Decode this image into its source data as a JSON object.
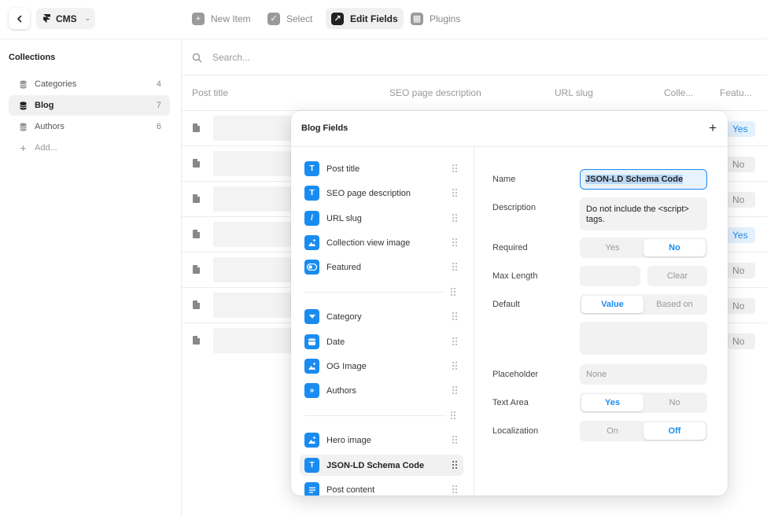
{
  "toolbar": {
    "app_name": "CMS",
    "new_item": "New Item",
    "select": "Select",
    "edit_fields": "Edit Fields",
    "plugins": "Plugins"
  },
  "sidebar": {
    "heading": "Collections",
    "items": [
      {
        "label": "Categories",
        "count": "4"
      },
      {
        "label": "Blog",
        "count": "7"
      },
      {
        "label": "Authors",
        "count": "6"
      }
    ],
    "add": "Add..."
  },
  "search": {
    "placeholder": "Search..."
  },
  "table": {
    "columns": [
      "Post title",
      "SEO page description",
      "URL slug",
      "Colle...",
      "Featu..."
    ],
    "featured": [
      "Yes",
      "No",
      "No",
      "Yes",
      "No",
      "No",
      "No"
    ]
  },
  "modal": {
    "title": "Blog Fields",
    "fields_group1": [
      {
        "label": "Post title",
        "icon": "T"
      },
      {
        "label": "SEO page description",
        "icon": "T"
      },
      {
        "label": "URL slug",
        "icon": "/"
      },
      {
        "label": "Collection view image",
        "icon": "image"
      },
      {
        "label": "Featured",
        "icon": "toggle"
      }
    ],
    "fields_group2": [
      {
        "label": "Category",
        "icon": "dropdown"
      },
      {
        "label": "Date",
        "icon": "date"
      },
      {
        "label": "OG Image",
        "icon": "image"
      },
      {
        "label": "Authors",
        "icon": "reference"
      }
    ],
    "fields_group3": [
      {
        "label": "Hero image",
        "icon": "image"
      },
      {
        "label": "JSON-LD Schema Code",
        "icon": "T"
      },
      {
        "label": "Post content",
        "icon": "richtext"
      }
    ],
    "props": {
      "name_label": "Name",
      "name_value": "JSON-LD Schema Code",
      "description_label": "Description",
      "description_value": "Do not include the <script> tags.",
      "required_label": "Required",
      "required_yes": "Yes",
      "required_no": "No",
      "maxlength_label": "Max Length",
      "clear": "Clear",
      "default_label": "Default",
      "default_value": "Value",
      "default_based_on": "Based on",
      "placeholder_label": "Placeholder",
      "placeholder_value": "None",
      "textarea_label": "Text Area",
      "textarea_yes": "Yes",
      "textarea_no": "No",
      "localization_label": "Localization",
      "localization_on": "On",
      "localization_off": "Off"
    }
  },
  "colors": {
    "accent": "#1a8cf0",
    "accent_bg": "#e3f1fd"
  }
}
